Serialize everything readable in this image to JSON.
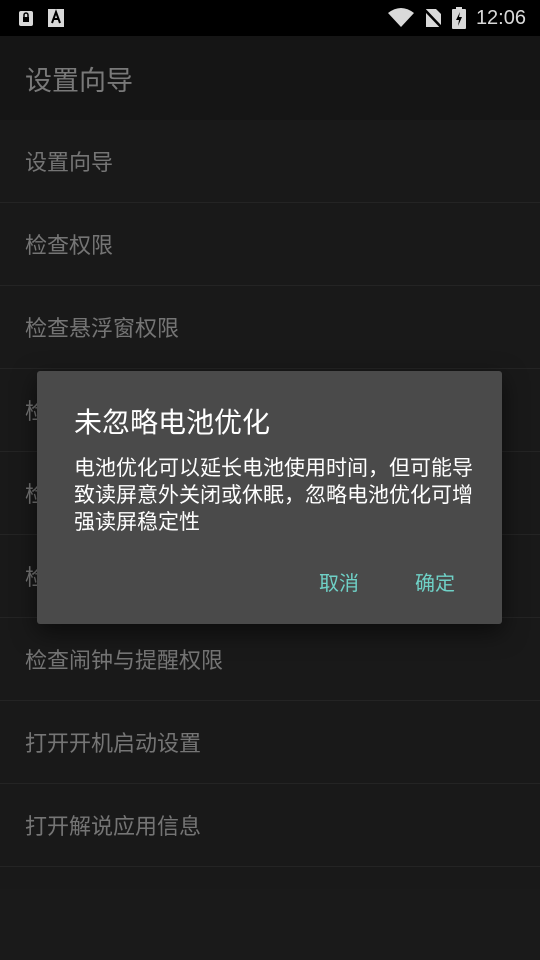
{
  "statusbar": {
    "time": "12:06",
    "icons": [
      "notification-lock-icon",
      "a-text-icon",
      "wifi-icon",
      "no-sim-icon",
      "battery-charging-icon"
    ]
  },
  "appbar": {
    "title": "设置向导"
  },
  "list": [
    {
      "label": "设置向导"
    },
    {
      "label": "检查权限"
    },
    {
      "label": "检查悬浮窗权限"
    },
    {
      "label": "检"
    },
    {
      "label": "检"
    },
    {
      "label": "检"
    },
    {
      "label": "检查闹钟与提醒权限"
    },
    {
      "label": "打开开机启动设置"
    },
    {
      "label": "打开解说应用信息"
    }
  ],
  "dialog": {
    "title": "未忽略电池优化",
    "message": "电池优化可以延长电池使用时间，但可能导致读屏意外关闭或休眠，忽略电池优化可增强读屏稳定性",
    "cancel": "取消",
    "confirm": "确定"
  },
  "colors": {
    "accent": "#6fd1c7",
    "dialog_bg": "#4a4a4a",
    "list_bg": "#1e1e1e"
  }
}
